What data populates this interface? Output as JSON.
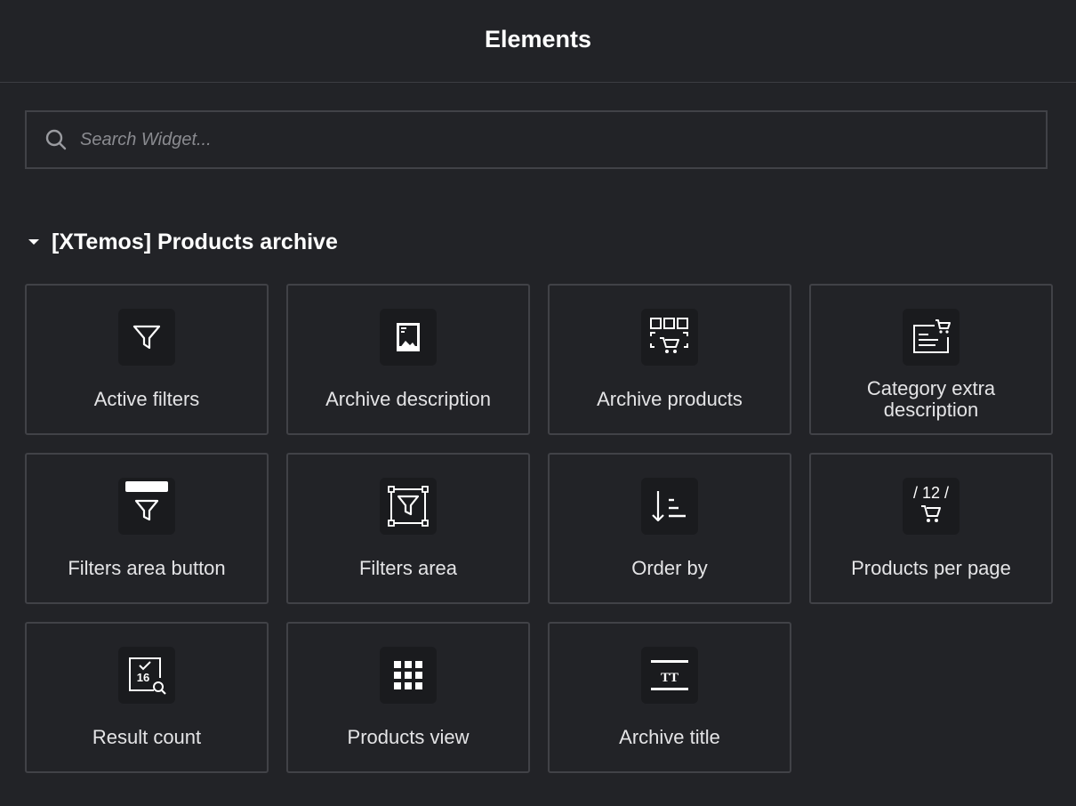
{
  "header": {
    "title": "Elements"
  },
  "search": {
    "placeholder": "Search Widget...",
    "value": ""
  },
  "section": {
    "title": "[XTemos] Products archive",
    "expanded": true,
    "widgets": [
      {
        "label": "Active filters",
        "icon": "funnel-icon"
      },
      {
        "label": "Archive description",
        "icon": "archive-description-icon"
      },
      {
        "label": "Archive products",
        "icon": "product-grid-cart-icon"
      },
      {
        "label": "Category extra description",
        "icon": "category-description-cart-icon"
      },
      {
        "label": "Filters area button",
        "icon": "filter-button-icon"
      },
      {
        "label": "Filters area",
        "icon": "filters-area-icon"
      },
      {
        "label": "Order by",
        "icon": "sort-order-icon"
      },
      {
        "label": "Products per page",
        "icon": "products-per-page-icon",
        "icon_text": "/ 12 /"
      },
      {
        "label": "Result count",
        "icon": "result-count-icon",
        "icon_text": "16"
      },
      {
        "label": "Products view",
        "icon": "grid-view-icon"
      },
      {
        "label": "Archive title",
        "icon": "archive-title-icon",
        "icon_text": "TT"
      }
    ]
  },
  "colors": {
    "background": "#222327",
    "border": "#414247",
    "icon_tile": "#1a1b1e",
    "text": "#e4e4e6",
    "placeholder": "#8a8b90"
  }
}
